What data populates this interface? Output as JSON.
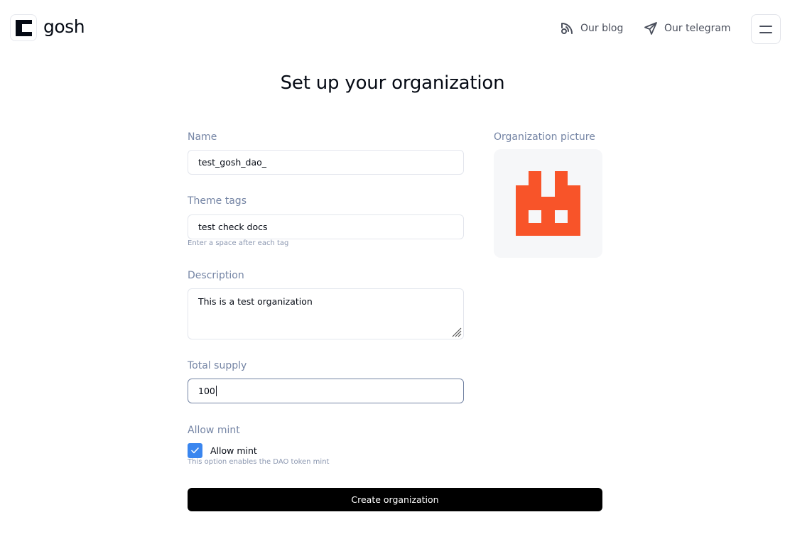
{
  "header": {
    "logo_text": "gosh",
    "nav": [
      {
        "label": "Our blog",
        "icon": "rss-icon"
      },
      {
        "label": "Our telegram",
        "icon": "send-icon"
      }
    ],
    "menu_icon": "hamburger-icon"
  },
  "page": {
    "title": "Set up your organization"
  },
  "form": {
    "name": {
      "label": "Name",
      "value": "test_gosh_dao_"
    },
    "tags": {
      "label": "Theme tags",
      "value": "test check docs",
      "hint": "Enter a space after each tag"
    },
    "description": {
      "label": "Description",
      "value": "This is a test organization"
    },
    "supply": {
      "label": "Total supply",
      "value": "100"
    },
    "mint": {
      "section_label": "Allow mint",
      "checkbox_label": "Allow mint",
      "checked": true,
      "hint": "This option enables the DAO token mint"
    },
    "picture": {
      "label": "Organization picture",
      "avatar_color": "#f85429"
    },
    "submit_label": "Create organization"
  },
  "colors": {
    "accent": "#3a86ef",
    "label": "#7585a5",
    "button": "#000000"
  }
}
